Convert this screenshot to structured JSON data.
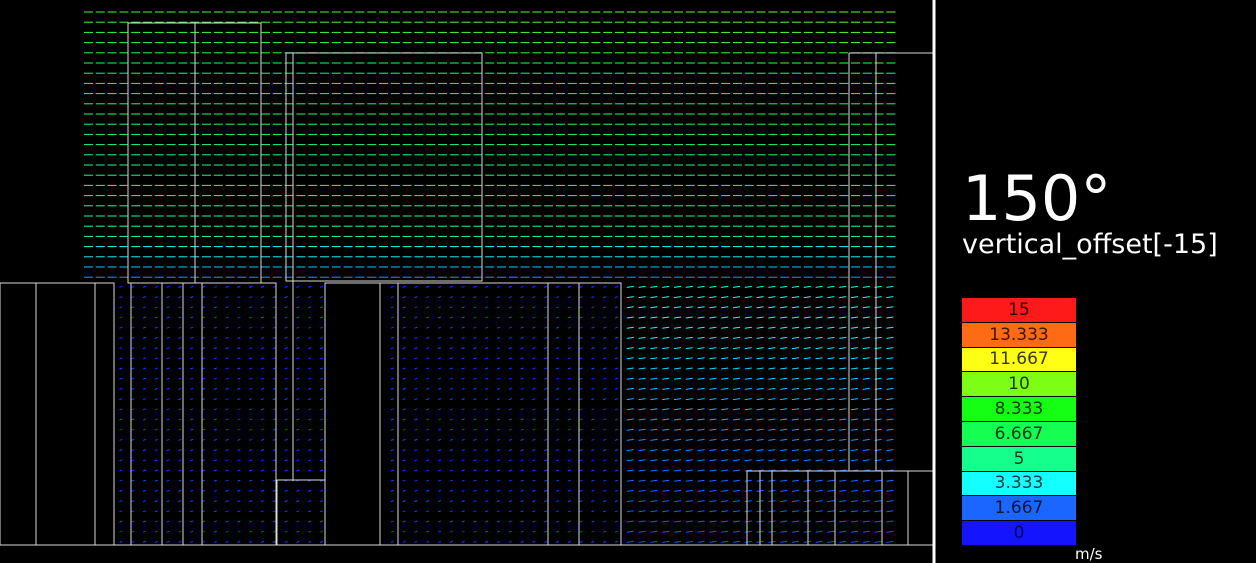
{
  "header": {
    "angle": "150°",
    "subtitle": "vertical_offset[-15]"
  },
  "legend": {
    "units": "m/s",
    "entries": [
      {
        "label": "15",
        "color": "#ff1a1a",
        "text": "#2a0000"
      },
      {
        "label": "13.333",
        "color": "#ff6a14",
        "text": "#3a1500"
      },
      {
        "label": "11.667",
        "color": "#ffff14",
        "text": "#3a3a00"
      },
      {
        "label": "10",
        "color": "#7cff14",
        "text": "#1d3a00"
      },
      {
        "label": "8.333",
        "color": "#14ff14",
        "text": "#003a00"
      },
      {
        "label": "6.667",
        "color": "#14ff52",
        "text": "#003a14"
      },
      {
        "label": "5",
        "color": "#14ff8c",
        "text": "#003a20"
      },
      {
        "label": "3.333",
        "color": "#14ffff",
        "text": "#003a3a"
      },
      {
        "label": "1.667",
        "color": "#1a66ff",
        "text": "#00163a"
      },
      {
        "label": "0",
        "color": "#1414ff",
        "text": "#000a5a"
      }
    ]
  }
}
